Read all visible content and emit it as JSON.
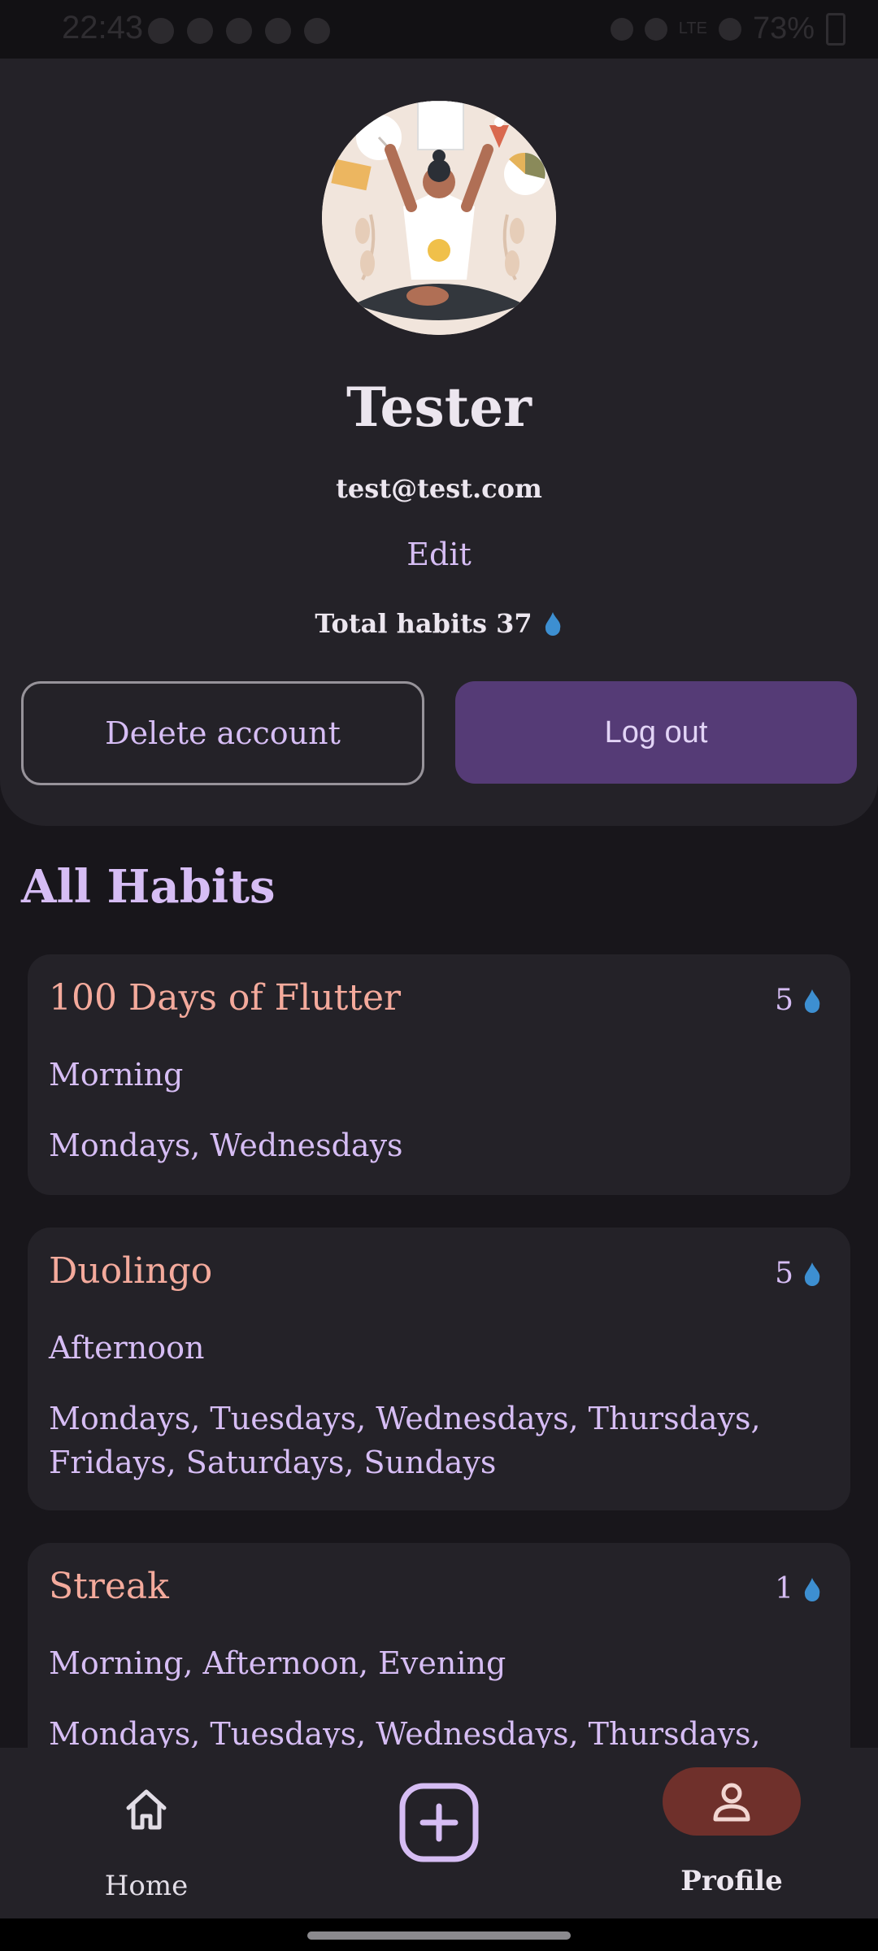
{
  "status_bar": {
    "time": "22:43",
    "network": "LTE",
    "battery": "73%"
  },
  "profile": {
    "name": "Tester",
    "email": "test@test.com",
    "edit_label": "Edit",
    "total_habits_label": "Total habits 37",
    "delete_label": "Delete account",
    "logout_label": "Log out"
  },
  "section_title": "All Habits",
  "habits": [
    {
      "name": "100 Days of  Flutter",
      "streak": "5",
      "time": "Morning",
      "days": "Mondays, Wednesdays"
    },
    {
      "name": "Duolingo",
      "streak": "5",
      "time": "Afternoon",
      "days": "Mondays, Tuesdays, Wednesdays, Thursdays, Fridays, Saturdays, Sundays"
    },
    {
      "name": "Streak",
      "streak": "1",
      "time": "Morning, Afternoon, Evening",
      "days": "Mondays, Tuesdays, Wednesdays, Thursdays,"
    }
  ],
  "nav": {
    "home_label": "Home",
    "profile_label": "Profile"
  },
  "icons": {
    "home": "home-icon",
    "add": "add-box-icon",
    "profile": "person-icon",
    "streak": "flame-icon"
  },
  "colors": {
    "accent": "#d6bdf4",
    "habit_title": "#f4aa9c",
    "flame": "#3d8fd1",
    "logout_button": "#553b76",
    "profile_pill": "#6f302b"
  }
}
